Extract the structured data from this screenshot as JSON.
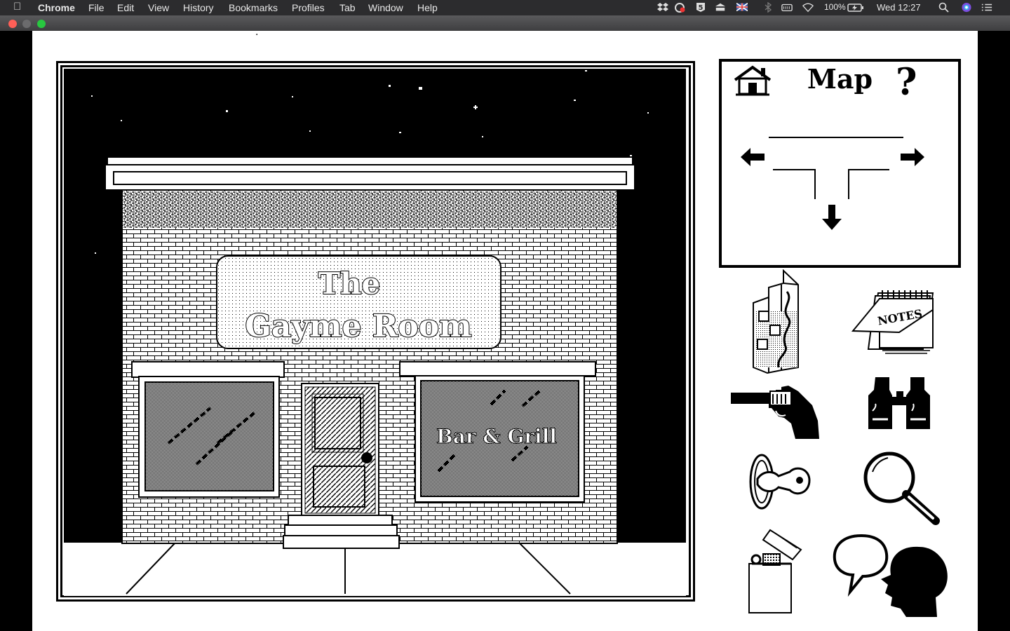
{
  "menubar": {
    "app_name": "Chrome",
    "menus": [
      "File",
      "Edit",
      "View",
      "History",
      "Bookmarks",
      "Profiles",
      "Tab",
      "Window",
      "Help"
    ],
    "battery": "100%",
    "clock": "Wed 12:27"
  },
  "page": {
    "top_fragment": "."
  },
  "scene": {
    "sign_line1": "The",
    "sign_line2": "Gayme Room",
    "window_sign": "Bar & Grill"
  },
  "map_panel": {
    "title": "Map",
    "help": "?",
    "home_icon": "house-icon",
    "nav": [
      "left-arrow-icon",
      "right-arrow-icon",
      "down-arrow-icon"
    ]
  },
  "inventory": {
    "notes_label": "NOTES",
    "items": [
      "map-icon",
      "notes-icon",
      "revolver-icon",
      "binoculars-icon",
      "key-icon",
      "magnifier-icon",
      "lighter-icon",
      "talk-icon"
    ]
  },
  "colors": {
    "ink": "#000000",
    "paper": "#ffffff"
  }
}
